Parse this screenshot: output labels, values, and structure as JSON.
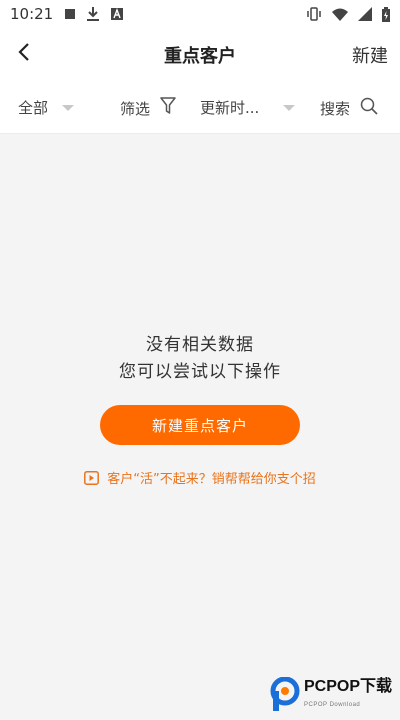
{
  "status_bar": {
    "time": "10:21",
    "left_icons": [
      "stop-square-icon",
      "download-icon",
      "font-a-icon"
    ],
    "right_icons": [
      "vibrate-icon",
      "wifi-icon",
      "signal-icon",
      "battery-charging-icon"
    ]
  },
  "header": {
    "back_icon": "chevron-left-icon",
    "title": "重点客户",
    "new_label": "新建"
  },
  "filters": {
    "all_label": "全部",
    "screen_label": "筛选",
    "update_label": "更新时...",
    "search_label": "搜索"
  },
  "empty_state": {
    "line1": "没有相关数据",
    "line2": "您可以尝试以下操作",
    "primary_button": "新建重点客户",
    "help_link": "客户“活”不起来？销帮帮给你支个招"
  },
  "watermark": {
    "text": "PCPOP下载",
    "sub": "PCPOP Download"
  },
  "colors": {
    "accent": "#ff6a00",
    "link": "#e8741d",
    "background": "#f4f4f4"
  }
}
